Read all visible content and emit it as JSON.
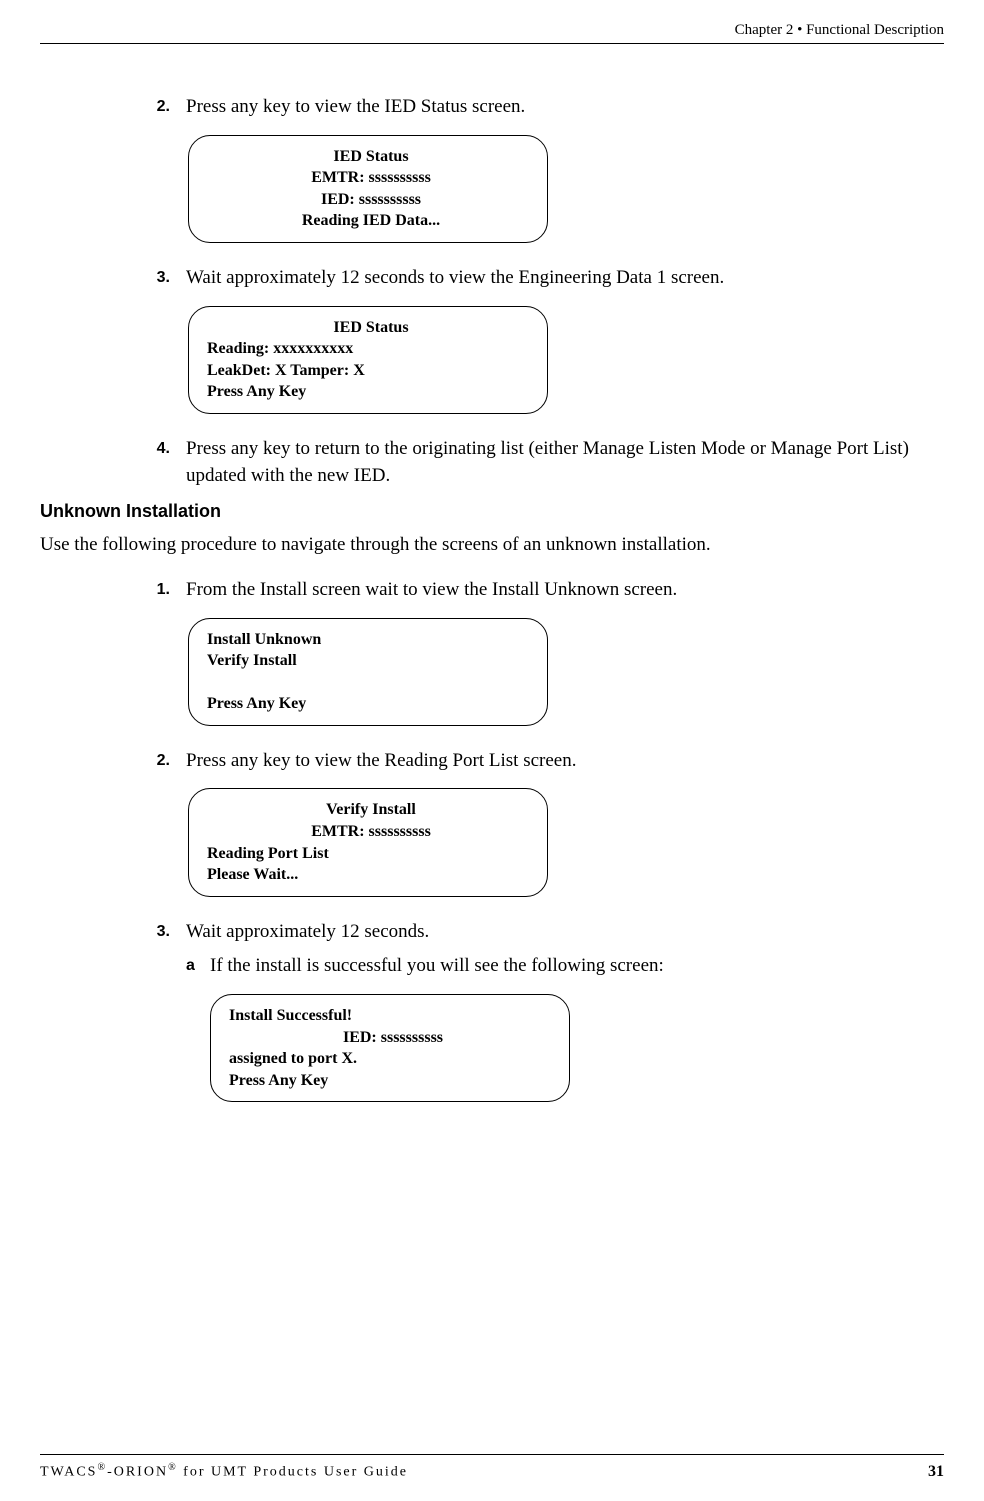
{
  "header": {
    "chapter": "Chapter 2 • Functional Description"
  },
  "steps": {
    "s2": {
      "num": "2.",
      "text": "Press any key to view the IED Status screen."
    },
    "s3": {
      "num": "3.",
      "text": "Wait approximately 12 seconds to view the Engineering Data 1 screen."
    },
    "s4": {
      "num": "4.",
      "text": "Press any key to return to the originating list (either Manage Listen Mode or Manage Port List) updated with the new IED."
    }
  },
  "lcd1": {
    "l1": "IED Status",
    "l2": "EMTR:  ssssssssss",
    "l3": "IED:  ssssssssss",
    "l4": "Reading IED Data..."
  },
  "lcd2": {
    "l1": "IED Status",
    "l2": "Reading:  xxxxxxxxxx",
    "l3": "LeakDet:  X  Tamper:  X",
    "l4": "Press Any Key"
  },
  "section": {
    "heading": "Unknown Installation",
    "intro": "Use the following procedure to navigate through the screens of an unknown installation."
  },
  "usteps": {
    "u1": {
      "num": "1.",
      "text": "From the Install screen wait to view the Install Unknown screen."
    },
    "u2": {
      "num": "2.",
      "text": "Press any key to view the Reading Port List screen."
    },
    "u3": {
      "num": "3.",
      "text": "Wait approximately 12 seconds."
    },
    "uA": {
      "label": "a",
      "text": "If the install is successful you will see the following screen:"
    }
  },
  "lcd3": {
    "l1": "Install Unknown",
    "l2": "Verify Install",
    "l3": "",
    "l4": "Press Any Key"
  },
  "lcd4": {
    "l1": "Verify Install",
    "l2": "EMTR:  ssssssssss",
    "l3": "Reading Port List",
    "l4": "Please Wait..."
  },
  "lcd5": {
    "l1": "Install Successful!",
    "l2": "IED:  ssssssssss",
    "l3": "assigned to port X.",
    "l4": "Press Any Key"
  },
  "footer": {
    "product_prefix": "TWACS",
    "product_mid": "-ORION",
    "product_suffix": " for UMT Products User Guide",
    "page_number": "31",
    "reg": "®"
  }
}
